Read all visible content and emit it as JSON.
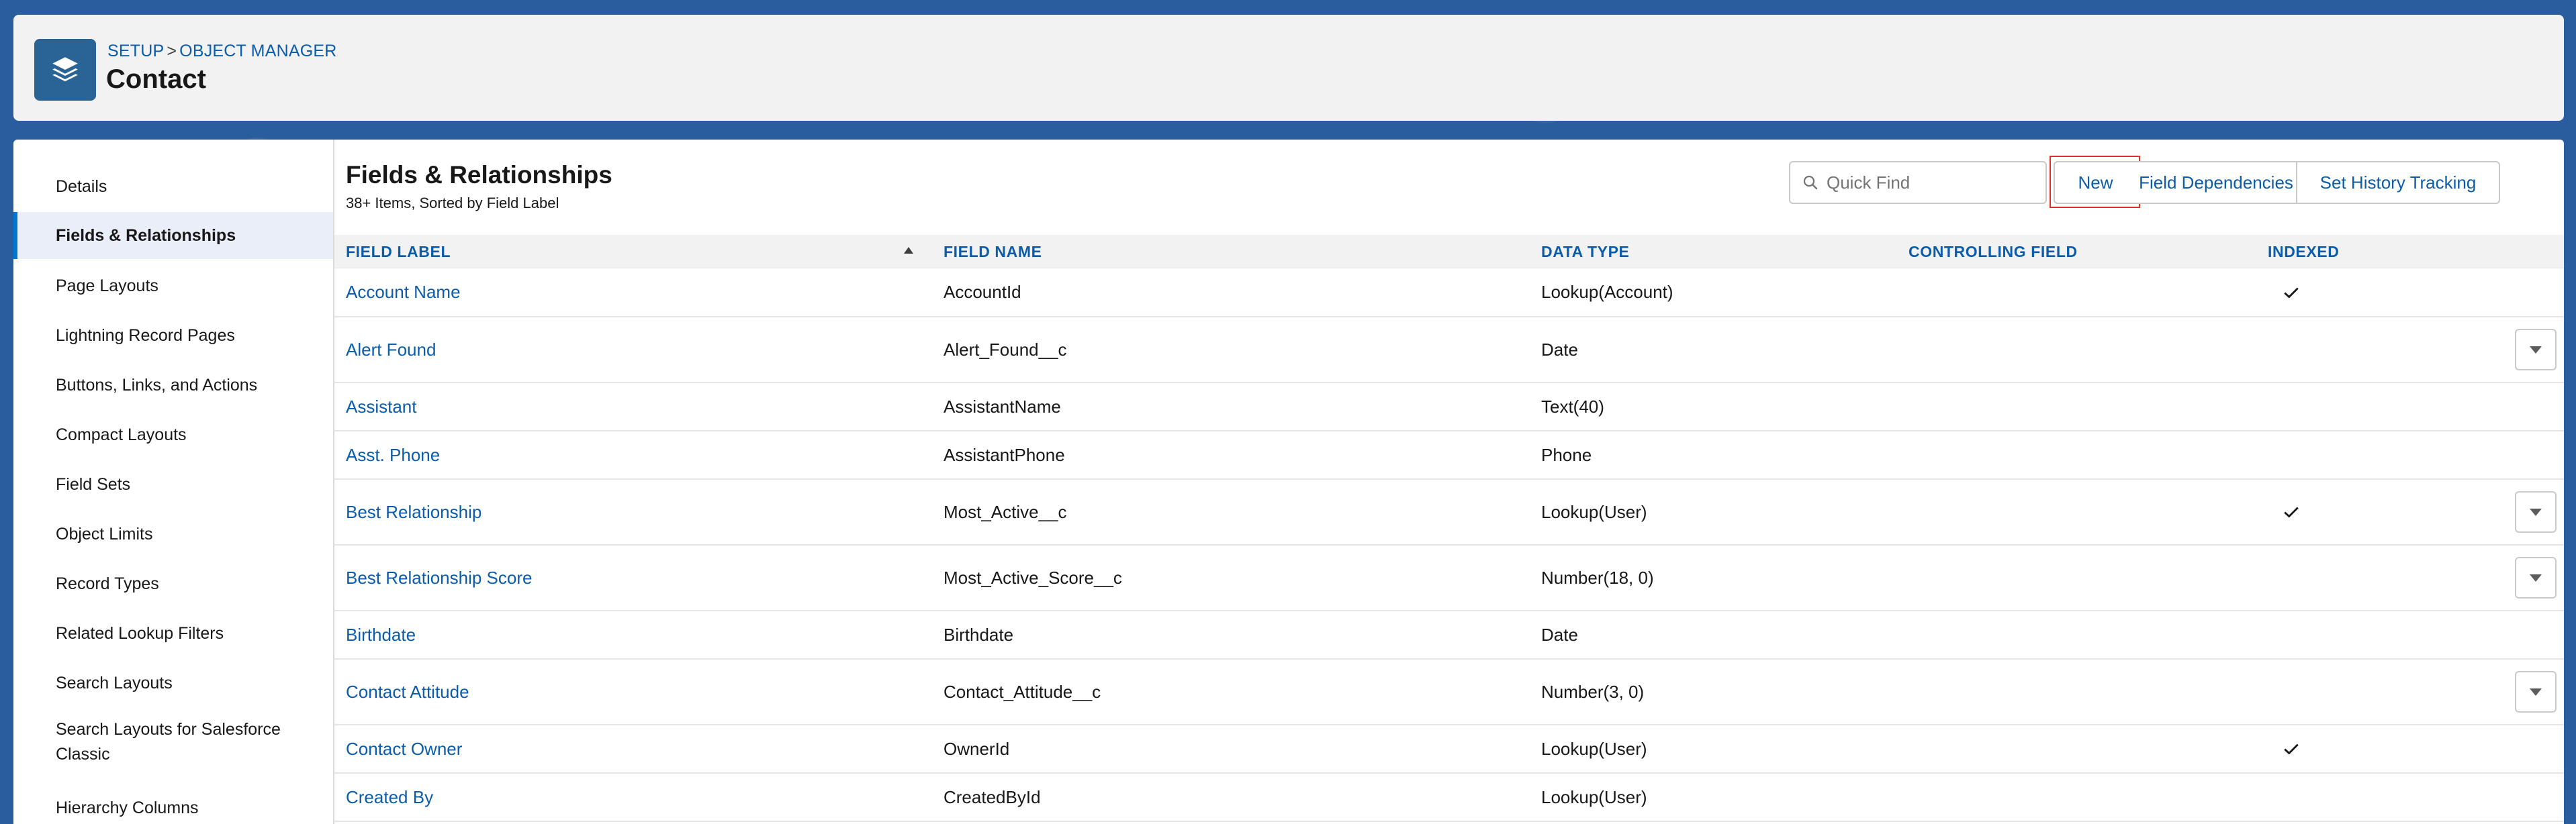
{
  "header": {
    "breadcrumb": [
      "SETUP",
      "OBJECT MANAGER"
    ],
    "breadcrumb_separator": ">",
    "title": "Contact",
    "icon": "layers-icon"
  },
  "sidebar": {
    "items": [
      {
        "label": "Details",
        "active": false
      },
      {
        "label": "Fields & Relationships",
        "active": true
      },
      {
        "label": "Page Layouts",
        "active": false
      },
      {
        "label": "Lightning Record Pages",
        "active": false
      },
      {
        "label": "Buttons, Links, and Actions",
        "active": false
      },
      {
        "label": "Compact Layouts",
        "active": false
      },
      {
        "label": "Field Sets",
        "active": false
      },
      {
        "label": "Object Limits",
        "active": false
      },
      {
        "label": "Record Types",
        "active": false
      },
      {
        "label": "Related Lookup Filters",
        "active": false
      },
      {
        "label": "Search Layouts",
        "active": false
      },
      {
        "label": "Search Layouts for Salesforce Classic",
        "active": false
      },
      {
        "label": "Hierarchy Columns",
        "active": false
      }
    ]
  },
  "content": {
    "title": "Fields & Relationships",
    "subtitle": "38+ Items, Sorted by Field Label",
    "search": {
      "placeholder": "Quick Find",
      "value": ""
    },
    "buttons": {
      "new": "New",
      "field_dependencies": "Field Dependencies",
      "set_history_tracking": "Set History Tracking"
    },
    "columns": [
      "FIELD LABEL",
      "FIELD NAME",
      "DATA TYPE",
      "CONTROLLING FIELD",
      "INDEXED"
    ],
    "sort": {
      "column": "FIELD LABEL",
      "direction": "ascending"
    },
    "rows": [
      {
        "label": "Account Name",
        "name": "AccountId",
        "type": "Lookup(Account)",
        "controlling": "",
        "indexed": true,
        "menu": false
      },
      {
        "label": "Alert Found",
        "name": "Alert_Found__c",
        "type": "Date",
        "controlling": "",
        "indexed": false,
        "menu": true
      },
      {
        "label": "Assistant",
        "name": "AssistantName",
        "type": "Text(40)",
        "controlling": "",
        "indexed": false,
        "menu": false
      },
      {
        "label": "Asst. Phone",
        "name": "AssistantPhone",
        "type": "Phone",
        "controlling": "",
        "indexed": false,
        "menu": false
      },
      {
        "label": "Best Relationship",
        "name": "Most_Active__c",
        "type": "Lookup(User)",
        "controlling": "",
        "indexed": true,
        "menu": true
      },
      {
        "label": "Best Relationship Score",
        "name": "Most_Active_Score__c",
        "type": "Number(18, 0)",
        "controlling": "",
        "indexed": false,
        "menu": true
      },
      {
        "label": "Birthdate",
        "name": "Birthdate",
        "type": "Date",
        "controlling": "",
        "indexed": false,
        "menu": false
      },
      {
        "label": "Contact Attitude",
        "name": "Contact_Attitude__c",
        "type": "Number(3, 0)",
        "controlling": "",
        "indexed": false,
        "menu": true
      },
      {
        "label": "Contact Owner",
        "name": "OwnerId",
        "type": "Lookup(User)",
        "controlling": "",
        "indexed": true,
        "menu": false
      },
      {
        "label": "Created By",
        "name": "CreatedById",
        "type": "Lookup(User)",
        "controlling": "",
        "indexed": false,
        "menu": false
      }
    ]
  },
  "colors": {
    "brand_blue": "#0b5cab",
    "header_icon": "#2a6496",
    "highlight_red": "#e0312b",
    "active_nav_bg": "#e9eef8"
  }
}
